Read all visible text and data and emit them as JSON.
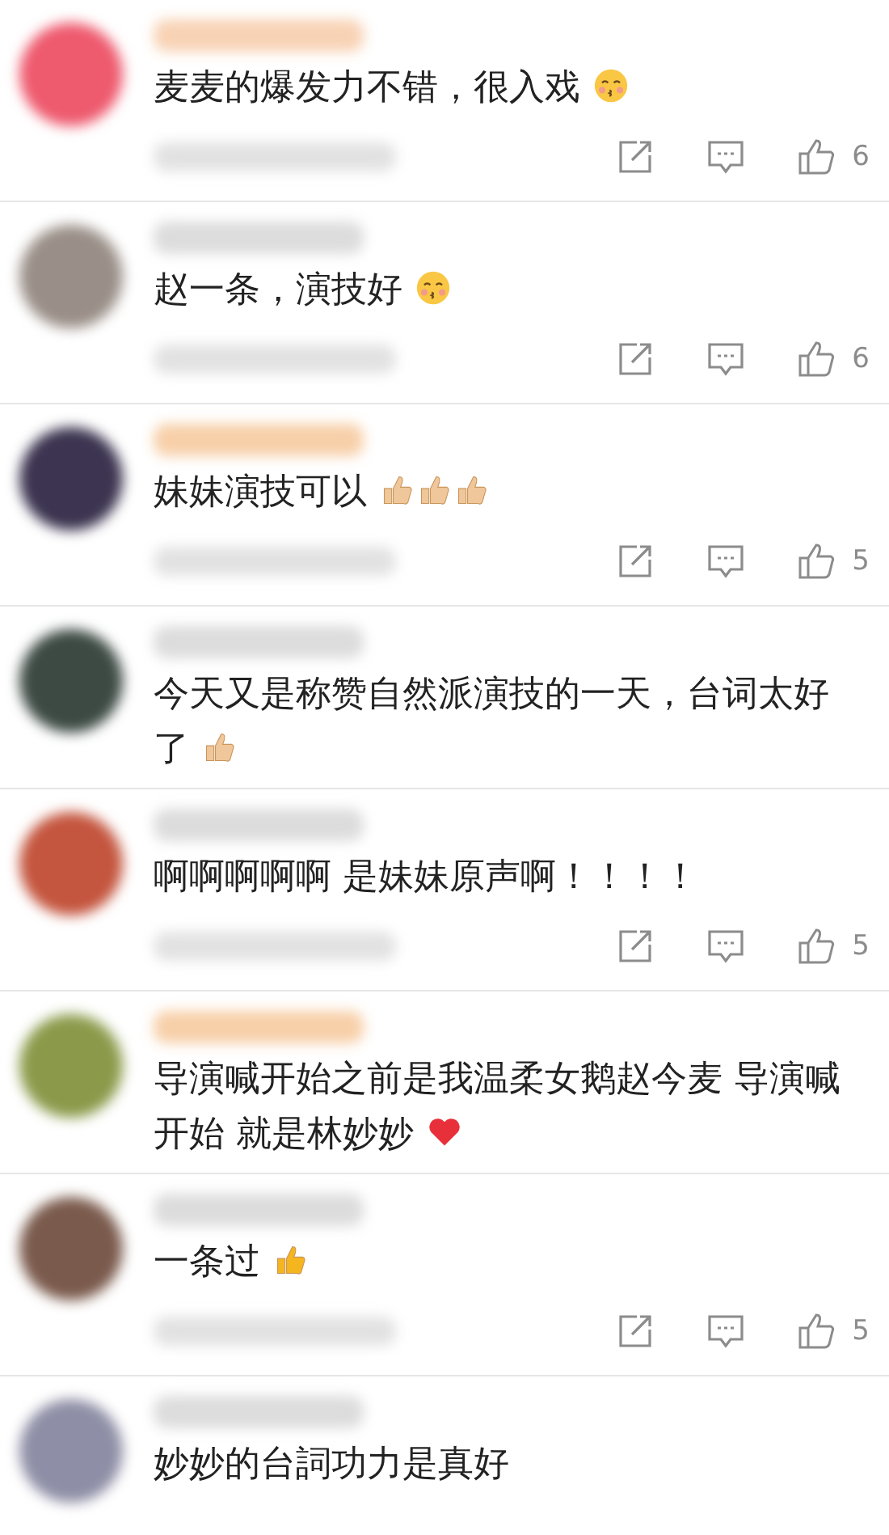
{
  "comments": [
    {
      "avatar": {
        "color": "#ee5a6e"
      },
      "name_redacted": {
        "color": "#f8d2b4"
      },
      "text": "麦麦的爆发力不错，很入戏",
      "emojis": [
        {
          "kind": "kiss"
        }
      ],
      "actions": {
        "likes": "6"
      }
    },
    {
      "avatar": {
        "color": "#9a8f88"
      },
      "name_redacted": {
        "color": "#dcdcdc"
      },
      "text": "赵一条，演技好",
      "emojis": [
        {
          "kind": "kiss"
        }
      ],
      "actions": {
        "likes": "6"
      }
    },
    {
      "avatar": {
        "color": "#3c3450"
      },
      "name_redacted": {
        "color": "#f7cfa8"
      },
      "text": "妹妹演技可以",
      "emojis": [
        {
          "kind": "thumb_light"
        },
        {
          "kind": "thumb_light"
        },
        {
          "kind": "thumb_light"
        }
      ],
      "actions": {
        "likes": "5"
      }
    },
    {
      "avatar": {
        "color": "#3d4a44"
      },
      "name_redacted": {
        "color": "#dcdcdc"
      },
      "text": "今天又是称赞自然派演技的一天，台词太好了",
      "emojis": [
        {
          "kind": "thumb_light"
        }
      ]
    },
    {
      "avatar": {
        "color": "#c4553e"
      },
      "name_redacted": {
        "color": "#dcdcdc"
      },
      "text": "啊啊啊啊啊 是妹妹原声啊！！！！",
      "actions": {
        "likes": "5"
      }
    },
    {
      "avatar": {
        "color": "#8a9a4a"
      },
      "name_redacted": {
        "color": "#f7cfa8"
      },
      "text": "导演喊开始之前是我温柔女鹅赵今麦 导演喊开始 就是林妙妙",
      "emojis": [
        {
          "kind": "heart"
        }
      ]
    },
    {
      "avatar": {
        "color": "#7a5a4c"
      },
      "name_redacted": {
        "color": "#dcdcdc"
      },
      "text": "一条过",
      "emojis": [
        {
          "kind": "thumb_yellow"
        }
      ],
      "actions": {
        "likes": "5"
      }
    },
    {
      "avatar": {
        "color": "#8e8ea6"
      },
      "name_redacted": {
        "color": "#dcdcdc"
      },
      "text": "妙妙的台詞功力是真好"
    }
  ]
}
